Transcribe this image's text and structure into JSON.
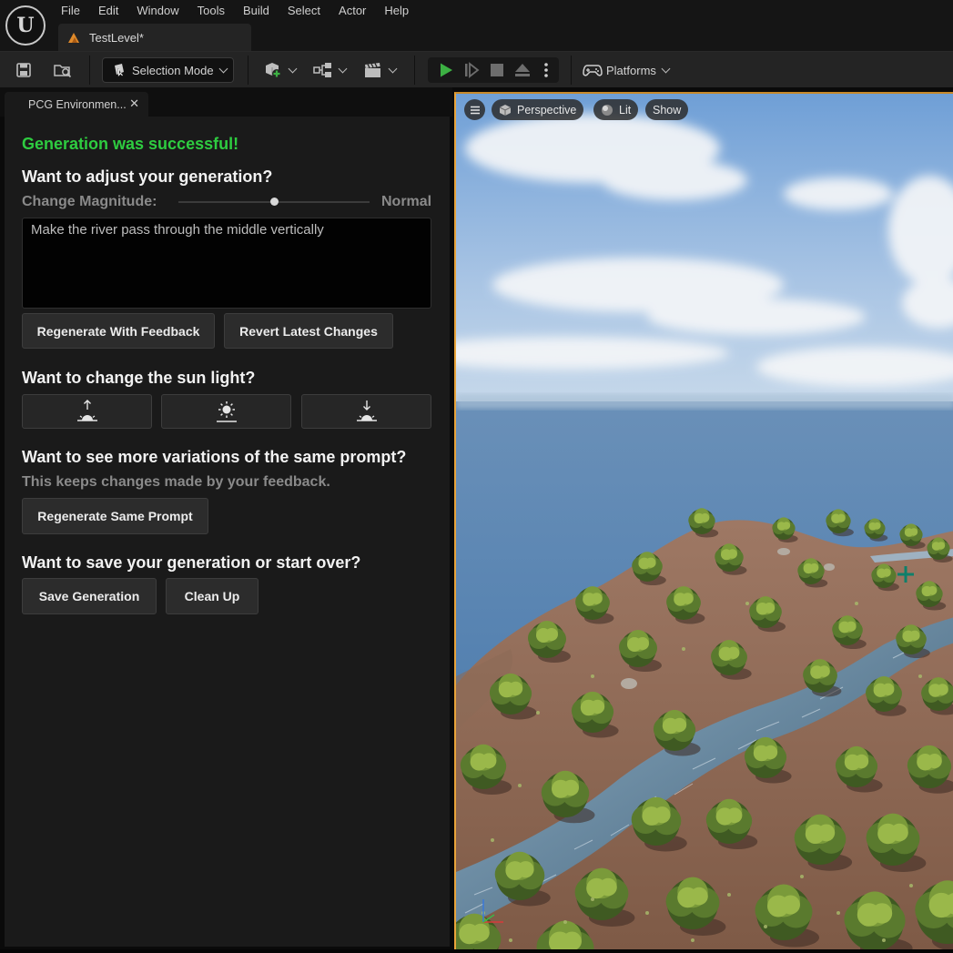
{
  "menu": {
    "items": [
      "File",
      "Edit",
      "Window",
      "Tools",
      "Build",
      "Select",
      "Actor",
      "Help"
    ]
  },
  "document_tab": {
    "title": "TestLevel*"
  },
  "toolbar": {
    "selection_mode": "Selection Mode",
    "platforms": "Platforms"
  },
  "panel": {
    "tab_title": "PCG Environmen...",
    "success_message": "Generation was successful!",
    "adjust_heading": "Want to adjust your generation?",
    "change_magnitude_label": "Change Magnitude:",
    "change_magnitude_value": "Normal",
    "change_magnitude_level": 0.5,
    "feedback_text": "Make the river pass through the middle vertically",
    "regenerate_feedback_label": "Regenerate With Feedback",
    "revert_label": "Revert Latest Changes",
    "sun_heading": "Want to change the sun light?",
    "sun_buttons": [
      "sunrise-icon",
      "noon-sun-icon",
      "sunset-icon"
    ],
    "variations_heading": "Want to see more variations of the same prompt?",
    "variations_note": "This keeps changes made by your feedback.",
    "regenerate_same_label": "Regenerate Same Prompt",
    "save_heading": "Want to save your generation or start over?",
    "save_label": "Save Generation",
    "cleanup_label": "Clean Up"
  },
  "viewport": {
    "perspective": "Perspective",
    "lit": "Lit",
    "show": "Show"
  },
  "colors": {
    "success": "#2ecc40",
    "play": "#3cb043",
    "viewport_border": "#e8a33a"
  }
}
